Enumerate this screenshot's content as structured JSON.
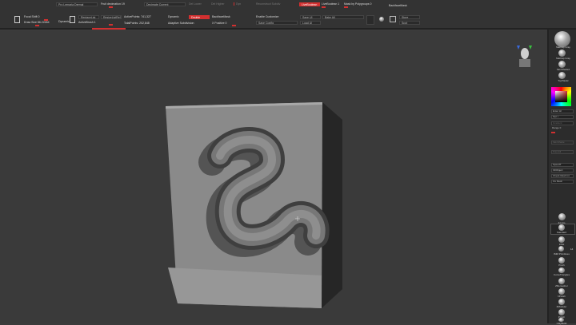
{
  "toolbar": {
    "row1": {
      "persp": "Pro Lemaria Dermal",
      "fp": "Fruit decimation 19",
      "decimate": "Decimate Current",
      "del_lower": "Del Lower",
      "del_higher": "Del Higher",
      "dyn": "Dyn",
      "reconstruct": "Reconstruct Subdiv",
      "live_boolean": "LiveBoolean",
      "live_boolean_2": "LiveBoolean 1",
      "mask_polygroups": "Mask by Polygroups 0",
      "backface_mask": "BackfaceMask"
    },
    "row2": {
      "focal_shift": "Focal Shift 0",
      "draw_size": "Draw Size 86.22484",
      "dynamic_small": "Dynamic",
      "replace_list": "ReplaceList",
      "create_list": "ResizeListRef",
      "active_b": "ActiveBrush 1",
      "active_points": "ActivePoints: 741,327",
      "total_points": "TotalPoints: 202,848",
      "dynamic": "Dynamic",
      "double": "Double",
      "backface": "BackfaceMask",
      "adaptive": "Adaptive Subdivision",
      "pinch": "X Positive 0",
      "enable_customize": "Enable Customize",
      "save_config": "Save Config",
      "save_ui": "Save UI",
      "load_ui": "Load UI",
      "bake_all": "Bake All",
      "store": "Store",
      "spot": "Spot"
    }
  },
  "right_panel": {
    "materials": [
      "MatCap Gray",
      "MatCap Gray",
      "SkinShade4",
      "ToyPlastic"
    ],
    "buttons": [
      "Enter HI",
      "Sec t",
      "Gradient",
      "Range 0",
      "SkinShade",
      "PolyrAll",
      "SpeedT",
      "FillObject",
      "Check Mesh Int",
      "Fix Mesh"
    ],
    "brushes": [
      "Z-Intro",
      "Standard",
      "Inflat",
      "IMM Primitives",
      "Pinch",
      "CurveTriangles",
      "ZRemesher",
      "hPolish",
      "ZModeler",
      "Polish",
      "ClayBuild"
    ],
    "count": "14"
  },
  "colors": {
    "accent": "#d23030",
    "viewport": "#3a3a3a"
  }
}
